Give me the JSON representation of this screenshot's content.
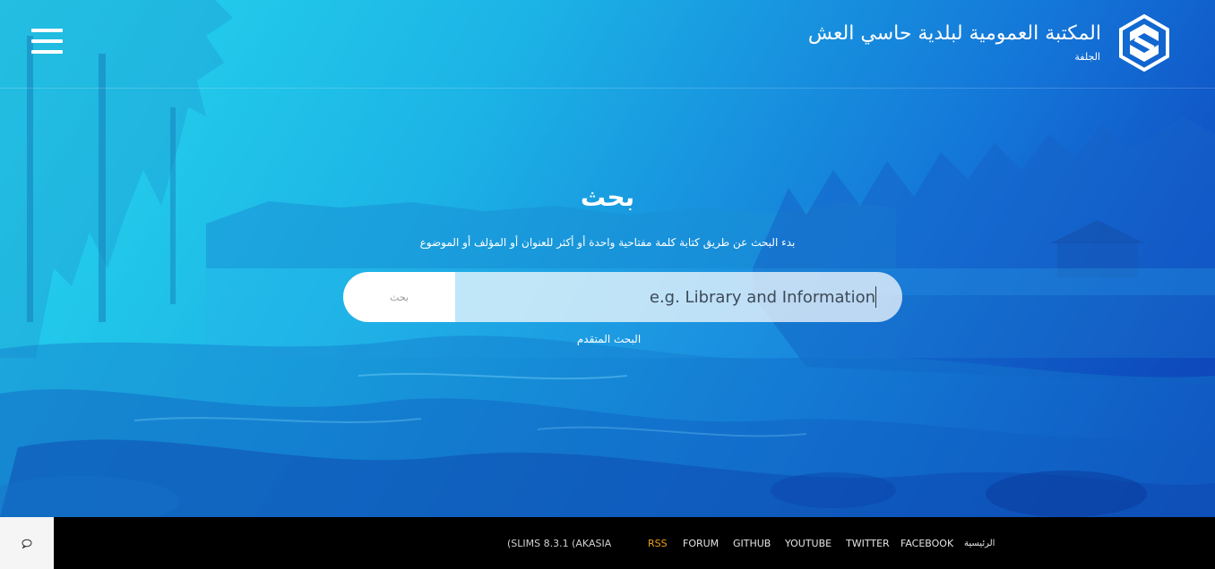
{
  "header": {
    "library_name": "المكتبة العمومية لبلدية حاسي العش",
    "library_location": "الجلفة",
    "logo_icon": "slims-logo-icon",
    "menu_icon": "hamburger-menu-icon"
  },
  "search": {
    "heading": "بحث",
    "description": "بدء البحث عن طريق كتابة كلمة مفتاحية واحدة أو أكثر للعنوان أو المؤلف أو الموضوع",
    "placeholder": "e.g. Library and Information",
    "button_label": "بحث",
    "advanced_link": "البحث المتقدم"
  },
  "footer": {
    "version": "(SLIMS 8.3.1 (AKASIA",
    "links": {
      "home": "الرئيسية",
      "facebook": "FACEBOOK",
      "twitter": "TWITTER",
      "youtube": "YOUTUBE",
      "github": "GITHUB",
      "forum": "FORUM",
      "rss": "RSS"
    },
    "chat_icon": "chat-bubble-icon"
  },
  "colors": {
    "rss_accent": "#f0a020",
    "footer_bg": "#000000",
    "hero_gradient_start": "#27d8ec",
    "hero_gradient_end": "#0c38b8"
  }
}
